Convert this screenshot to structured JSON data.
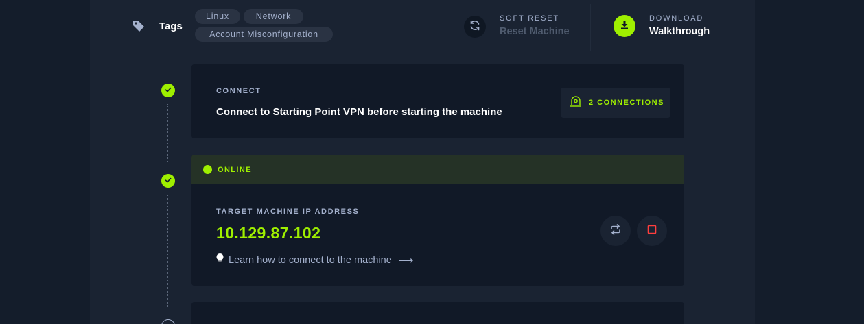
{
  "header": {
    "tags_label": "Tags",
    "tags": [
      "Linux",
      "Network",
      "Account Misconfiguration"
    ],
    "soft_reset": {
      "kicker": "SOFT RESET",
      "title": "Reset Machine"
    },
    "download": {
      "kicker": "DOWNLOAD",
      "title": "Walkthrough"
    }
  },
  "steps": {
    "connect": {
      "kicker": "CONNECT",
      "title": "Connect to Starting Point VPN before starting the machine",
      "connections_label": "2 CONNECTIONS"
    },
    "machine": {
      "status": "ONLINE",
      "ip_kicker": "TARGET MACHINE IP ADDRESS",
      "ip": "10.129.87.102",
      "learn_link": "Learn how to connect to the machine",
      "learn_arrow": "⟶"
    }
  },
  "colors": {
    "accent": "#9fef00",
    "background": "#141d2b",
    "panel": "#1a2332",
    "card": "#111927",
    "muted_text": "#a4b1cd",
    "online_bar": "#253226",
    "stop_red": "#ff3e3e"
  },
  "icons": [
    "tag-icon",
    "refresh-icon",
    "download-icon",
    "check-icon",
    "vpn-connection-icon",
    "lightbulb-icon",
    "switch-icon",
    "stop-icon"
  ]
}
